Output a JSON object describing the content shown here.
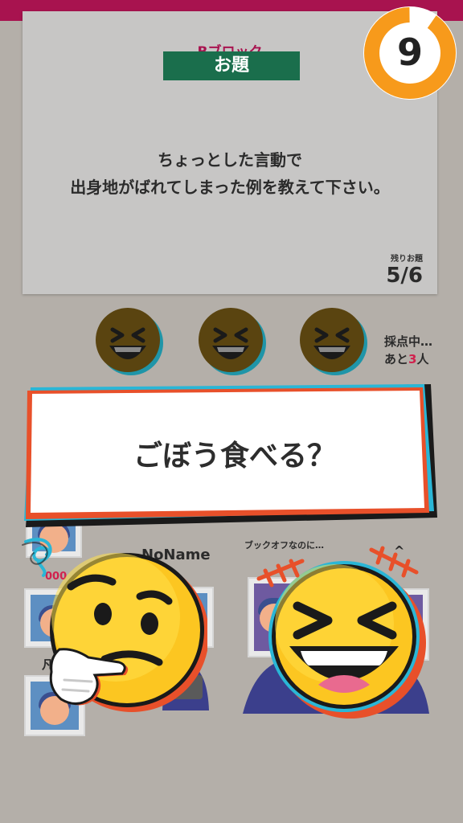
{
  "block_label": "Bブロック",
  "topic_label": "お題",
  "question_line1": "ちょっとした言動で",
  "question_line2": "出身地がばれてしまった例を教えて下さい。",
  "remaining_label": "残りお題",
  "remaining_count": "5/6",
  "timer_value": "9",
  "scoring_line1": "採点中…",
  "scoring_prefix": "あと",
  "scoring_count": "3",
  "scoring_suffix": "人",
  "answer_text": "ごぼう食べる？",
  "players": {
    "noname": "NoName",
    "bookoff": "ブックオフなのに…",
    "caret": "^",
    "score_partial": "000",
    "name_partial": "凡"
  },
  "colors": {
    "accent": "#a8134f",
    "topic_green": "#1a6e4c",
    "timer_orange": "#f79a1b",
    "answer_red": "#e8502a",
    "answer_cyan": "#2ab6d6"
  }
}
